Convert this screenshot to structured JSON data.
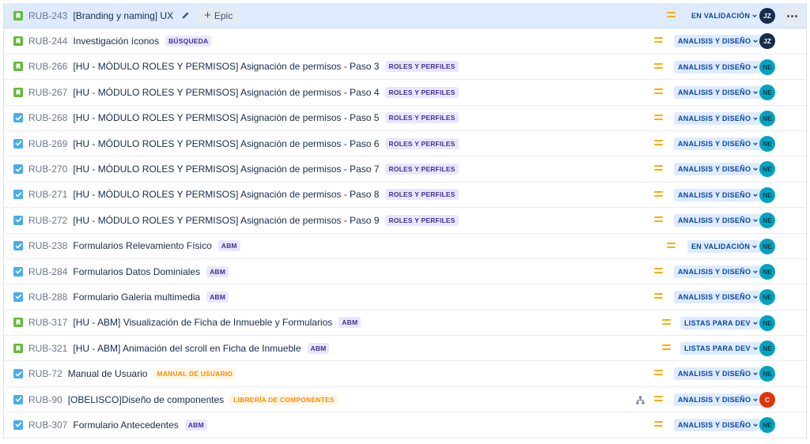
{
  "issues": [
    {
      "key": "RUB-243",
      "type": "story",
      "summary": "[Branding y naming] UX",
      "label": "",
      "labelColor": "",
      "status": "EN VALIDACIÓN",
      "avatar": "JZ",
      "avatarColor": "jz",
      "selected": true,
      "epicButton": "Epic"
    },
    {
      "key": "RUB-244",
      "type": "story",
      "summary": "Investigación íconos",
      "label": "BÚSQUEDA",
      "labelColor": "purple",
      "status": "ANALISIS Y DISEÑO",
      "avatar": "JZ",
      "avatarColor": "jz"
    },
    {
      "key": "RUB-266",
      "type": "story",
      "summary": "[HU - MÓDULO ROLES Y PERMISOS] Asignación de permisos - Paso 3",
      "label": "ROLES Y PERFILES",
      "labelColor": "purple",
      "status": "ANALISIS Y DISEÑO",
      "avatar": "NE",
      "avatarColor": "ne"
    },
    {
      "key": "RUB-267",
      "type": "story",
      "summary": "[HU - MÓDULO ROLES Y PERMISOS] Asignación de permisos - Paso 4",
      "label": "ROLES Y PERFILES",
      "labelColor": "purple",
      "status": "ANALISIS Y DISEÑO",
      "avatar": "NE",
      "avatarColor": "ne"
    },
    {
      "key": "RUB-268",
      "type": "task",
      "summary": "[HU - MÓDULO ROLES Y PERMISOS] Asignación de permisos - Paso 5",
      "label": "ROLES Y PERFILES",
      "labelColor": "purple",
      "status": "ANALISIS Y DISEÑO",
      "avatar": "NE",
      "avatarColor": "ne"
    },
    {
      "key": "RUB-269",
      "type": "task",
      "summary": "[HU - MÓDULO ROLES Y PERMISOS] Asignación de permisos - Paso 6",
      "label": "ROLES Y PERFILES",
      "labelColor": "purple",
      "status": "ANALISIS Y DISEÑO",
      "avatar": "NE",
      "avatarColor": "ne"
    },
    {
      "key": "RUB-270",
      "type": "task",
      "summary": "[HU - MÓDULO ROLES Y PERMISOS] Asignación de permisos - Paso 7",
      "label": "ROLES Y PERFILES",
      "labelColor": "purple",
      "status": "ANALISIS Y DISEÑO",
      "avatar": "NE",
      "avatarColor": "ne"
    },
    {
      "key": "RUB-271",
      "type": "task",
      "summary": "[HU - MÓDULO ROLES Y PERMISOS] Asignación de permisos - Paso 8",
      "label": "ROLES Y PERFILES",
      "labelColor": "purple",
      "status": "ANALISIS Y DISEÑO",
      "avatar": "NE",
      "avatarColor": "ne"
    },
    {
      "key": "RUB-272",
      "type": "task",
      "summary": "[HU - MÓDULO ROLES Y PERMISOS] Asignación de permisos - Paso 9",
      "label": "ROLES Y PERFILES",
      "labelColor": "purple",
      "status": "ANALISIS Y DISEÑO",
      "avatar": "NE",
      "avatarColor": "ne"
    },
    {
      "key": "RUB-238",
      "type": "task",
      "summary": "Formularios Relevamiento Físico",
      "label": "ABM",
      "labelColor": "purple",
      "status": "EN VALIDACIÓN",
      "avatar": "NE",
      "avatarColor": "ne"
    },
    {
      "key": "RUB-284",
      "type": "task",
      "summary": "Formularios Datos Dominiales",
      "label": "ABM",
      "labelColor": "purple",
      "status": "ANALISIS Y DISEÑO",
      "avatar": "NE",
      "avatarColor": "ne"
    },
    {
      "key": "RUB-288",
      "type": "task",
      "summary": "Formulario Galeria multimedia",
      "label": "ABM",
      "labelColor": "purple",
      "status": "ANALISIS Y DISEÑO",
      "avatar": "NE",
      "avatarColor": "ne"
    },
    {
      "key": "RUB-317",
      "type": "story",
      "summary": "[HU - ABM] Visualización de Ficha de Inmueble y Formularios",
      "label": "ABM",
      "labelColor": "purple",
      "status": "LISTAS PARA DEV",
      "avatar": "NE",
      "avatarColor": "ne"
    },
    {
      "key": "RUB-321",
      "type": "story",
      "summary": "[HU - ABM] Animación del scroll en Ficha de Inmueble",
      "label": "ABM",
      "labelColor": "purple",
      "status": "LISTAS PARA DEV",
      "avatar": "NE",
      "avatarColor": "ne"
    },
    {
      "key": "RUB-72",
      "type": "task",
      "summary": "Manual de Usuario",
      "label": "MANUAL DE USUARIO",
      "labelColor": "orange",
      "status": "ANALISIS Y DISEÑO",
      "avatar": "NE",
      "avatarColor": "ne"
    },
    {
      "key": "RUB-90",
      "type": "task",
      "summary": "[OBELISCO]Diseño de componentes",
      "label": "LIBRERÍA DE COMPONENTES",
      "labelColor": "orange",
      "status": "ANALISIS Y DISEÑO",
      "avatar": "C",
      "avatarColor": "c",
      "hierarchy": true
    },
    {
      "key": "RUB-307",
      "type": "task",
      "summary": "Formulario Antecedentes",
      "label": "ABM",
      "labelColor": "purple",
      "status": "ANALISIS Y DISEÑO",
      "avatar": "NE",
      "avatarColor": "ne"
    }
  ],
  "icons": {
    "story": "bookmark-icon",
    "task": "checkbox-icon",
    "priority": "priority-medium-icon",
    "edit": "pencil-icon",
    "more": "more-icon",
    "chevron": "chevron-down-icon",
    "hierarchy": "child-issues-icon"
  },
  "colors": {
    "story": "#63ba3c",
    "task": "#4bade8",
    "priority": "#ffab00",
    "statusBg": "#deebff",
    "statusText": "#0747a6",
    "selectedRow": "#deebff"
  }
}
